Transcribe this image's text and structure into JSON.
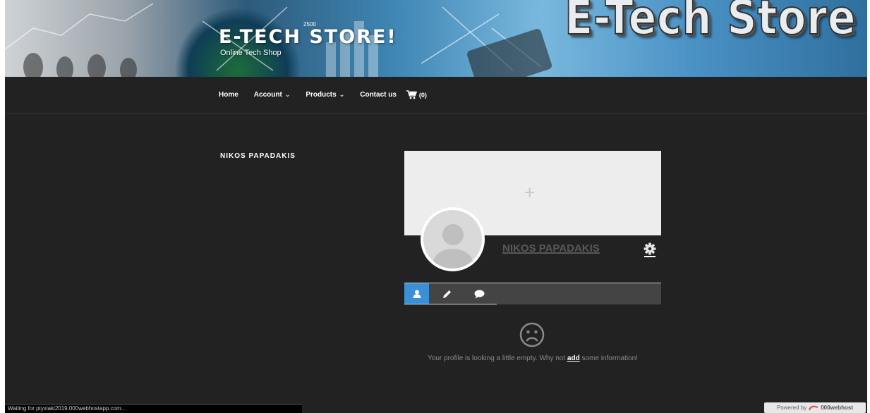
{
  "site": {
    "title": "E-TECH STORE!",
    "tagline": "Online Tech Shop",
    "banner_logo": "E-Tech Store",
    "banner_number": "2500"
  },
  "nav": {
    "items": [
      {
        "label": "Home",
        "dropdown": false
      },
      {
        "label": "Account",
        "dropdown": true
      },
      {
        "label": "Products",
        "dropdown": true
      },
      {
        "label": "Contact us",
        "dropdown": false
      }
    ],
    "cart_count": "(0)"
  },
  "sidebar": {
    "author_name": "NIKOS PAPADAKIS"
  },
  "profile": {
    "cover_add_symbol": "+",
    "display_name": "NIKOS PAPADAKIS",
    "tabs": [
      {
        "name": "profile",
        "icon": "user-icon",
        "active": true
      },
      {
        "name": "posts",
        "icon": "pencil-icon",
        "active": false
      },
      {
        "name": "comments",
        "icon": "comment-icon",
        "active": false
      }
    ],
    "empty_message_before": "Your profile is looking a little empty. Why not ",
    "empty_message_link": "add",
    "empty_message_after": " some information!"
  },
  "browser": {
    "status_text": "Waiting for ptyxiaki2019.000webhostapp.com..."
  },
  "footer": {
    "powered_by": "Powered by",
    "host_brand": "000webhost"
  },
  "colors": {
    "background": "#222222",
    "accent_tab": "#3a8fd6",
    "cover": "#ededed"
  }
}
